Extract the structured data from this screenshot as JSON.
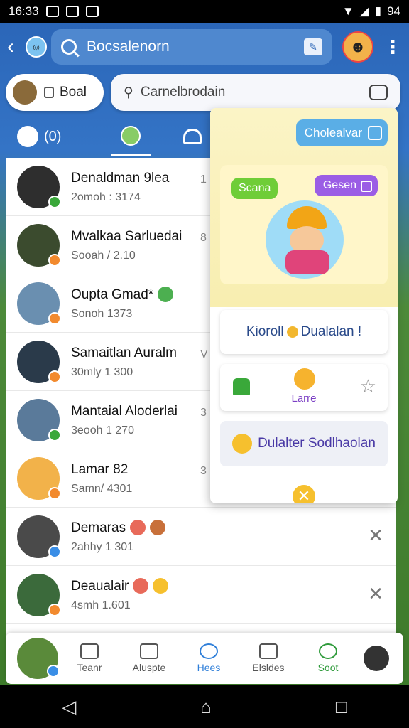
{
  "status": {
    "time": "16:33",
    "battery": "94"
  },
  "topbar": {
    "search_text": "Bocsalenorn"
  },
  "filter": {
    "pill_label": "Boal",
    "search_text": "Carnelbrodain"
  },
  "tabs": {
    "tab_a_label": "(0)"
  },
  "chats": [
    {
      "name": "Denaldman 9lea",
      "sub": "2omoh : 3174",
      "meta": "1",
      "dot": "#3aa83a",
      "avatar": "#2e2e2e"
    },
    {
      "name": "Mvalkaa Sarluedai",
      "sub": "Sooah / 2.10",
      "meta": "8",
      "dot": "#f28a2e",
      "avatar": "#3b4b2e"
    },
    {
      "name": "Oupta Gmad*",
      "sub": "Sonoh 1373",
      "meta": "",
      "dot": "#f28a2e",
      "avatar": "#6a8fb0"
    },
    {
      "name": "Samaitlan Auralm",
      "sub": "30mly 1 300",
      "meta": "V",
      "dot": "#f28a2e",
      "avatar": "#2a3a4a"
    },
    {
      "name": "Mantaial Aloderlai",
      "sub": "3eooh 1 270",
      "meta": "3",
      "dot": "#3aa83a",
      "avatar": "#5a7a9a"
    },
    {
      "name": "Lamar 82",
      "sub": "Samn/ 4301",
      "meta": "3",
      "dot": "#f28a2e",
      "avatar": "#f2b24a"
    },
    {
      "name": "Demaras",
      "sub": "2ahhy 1 301",
      "meta": "",
      "dot": "#3a8ee6",
      "avatar": "#4a4a4a"
    },
    {
      "name": "Deaualair",
      "sub": "4smh 1.601",
      "meta": "",
      "dot": "#f28a2e",
      "avatar": "#3b6a3b"
    }
  ],
  "panel": {
    "chat_button": "Cholealvar",
    "bubble_left": "Scana",
    "bubble_right": "Gesen",
    "card1_a": "Kioroll",
    "card1_b": "Dualalan !",
    "card2_label": "Larre",
    "card3_text": "Dulalter Sodlhaolan"
  },
  "bottomnav": {
    "items": [
      "Teanr",
      "Aluspte",
      "Hees",
      "Elsldes",
      "Soot"
    ]
  },
  "colors": {
    "brand": "#2b66b8",
    "accent": "#5aaee6",
    "purple": "#9b5de5",
    "green": "#6fcd38"
  }
}
